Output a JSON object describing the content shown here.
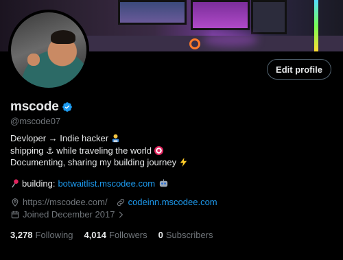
{
  "profile": {
    "display_name": "mscode",
    "handle": "@mscode07",
    "edit_profile_label": "Edit profile",
    "bio_lines": [
      "Devloper → Indie hacker",
      "shipping ⚓ while traveling the world",
      "Documenting, sharing my building journey"
    ],
    "building_label": "building:",
    "building_link": "botwaitlist.mscodee.com",
    "website_1": "https://mscodee.com/",
    "website_2": "codeinn.mscodee.com",
    "joined": "Joined December 2017"
  },
  "stats": [
    {
      "count": "3,278",
      "label": "Following"
    },
    {
      "count": "4,014",
      "label": "Followers"
    },
    {
      "count": "0",
      "label": "Subscribers"
    }
  ],
  "icons": [
    "verified-badge-icon",
    "location-icon",
    "link-icon",
    "calendar-icon",
    "chevron-right-icon",
    "pushpin-emoji",
    "technologist-emoji",
    "target-emoji",
    "lightning-emoji",
    "robot-emoji"
  ],
  "colors": {
    "background": "#000000",
    "text_primary": "#e7e9ea",
    "text_secondary": "#71767b",
    "link": "#1d9bf0",
    "border": "#536471",
    "verified": "#1d9bf0"
  }
}
